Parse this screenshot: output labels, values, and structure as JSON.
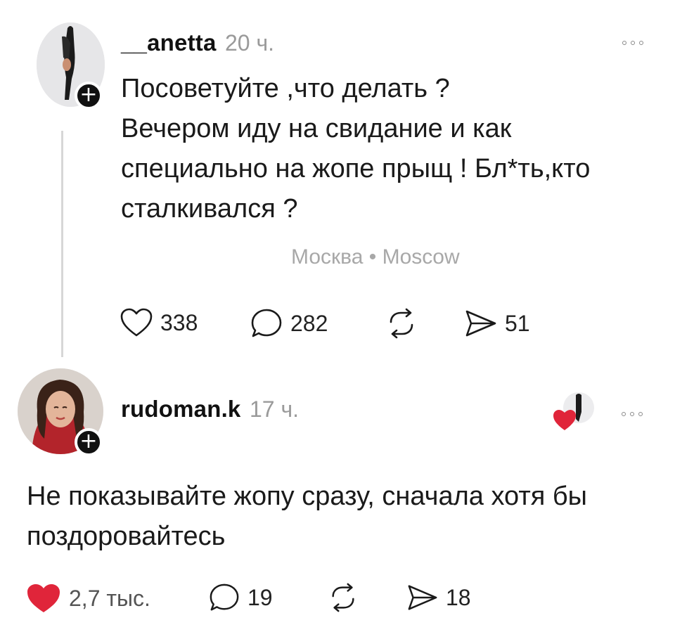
{
  "post": {
    "username": "__anetta",
    "time": "20 ч.",
    "lines": [
      "Посоветуйте ,что делать ?",
      "Вечером иду на свидание и как",
      "специально на жопе прыщ ! Бл*ть,кто",
      "сталкивался ?"
    ],
    "location": "Москва • Moscow",
    "likes": "338",
    "comments": "282",
    "shares": "51"
  },
  "reply": {
    "username": "rudoman.k",
    "time": "17 ч.",
    "lines": [
      "Не показывайте жопу сразу, сначала хотя бы",
      "поздоровайтесь"
    ],
    "likes": "2,7 тыс.",
    "comments": "19",
    "shares": "18"
  },
  "icons": {
    "follow": "+",
    "like": "heart-icon",
    "like_active": "heart-filled-icon",
    "comment": "comment-bubble-icon",
    "repost": "repost-arrows-icon",
    "share": "send-arrow-icon",
    "more": "more-dots-icon"
  },
  "colors": {
    "like_active": "#e0253a",
    "muted": "#9a9a9a"
  }
}
